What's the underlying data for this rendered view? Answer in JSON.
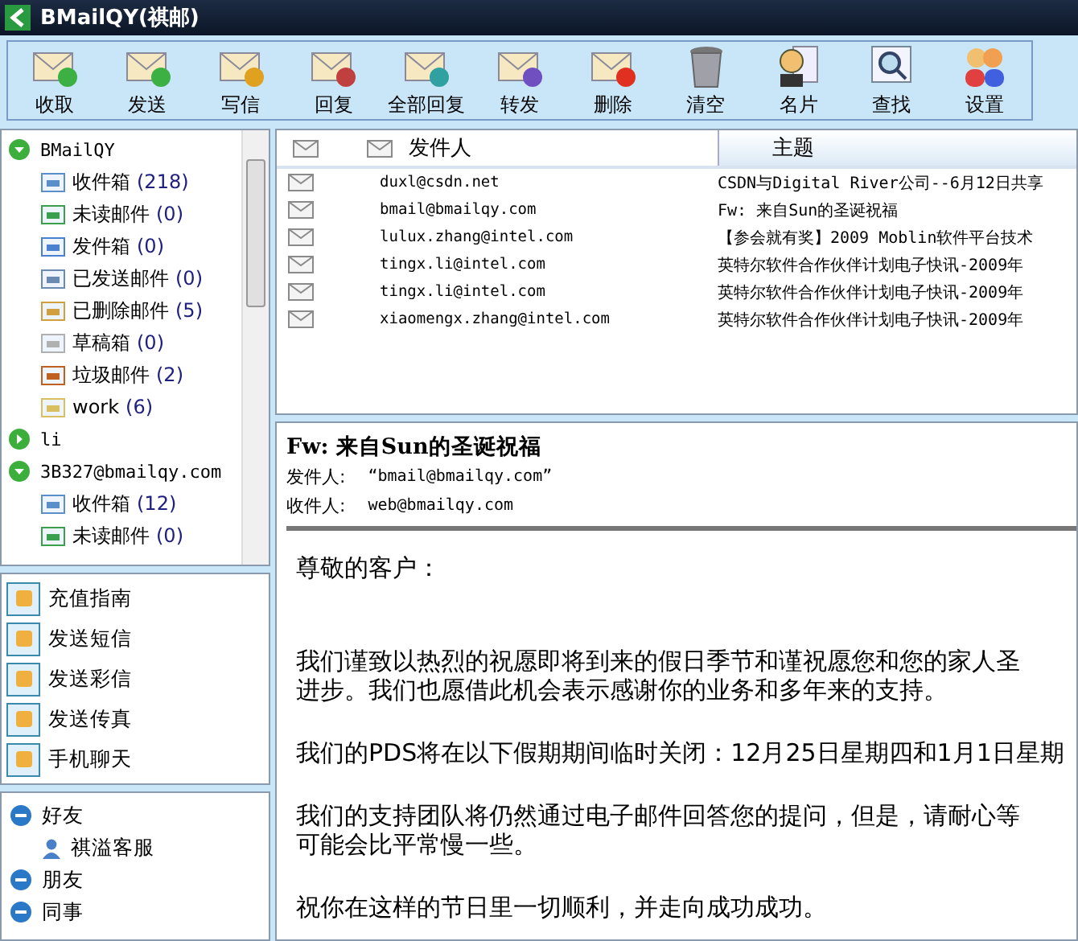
{
  "window": {
    "title": "BMailQY(祺邮)"
  },
  "toolbar": [
    "收取",
    "发送",
    "写信",
    "回复",
    "全部回复",
    "转发",
    "删除",
    "清空",
    "名片",
    "查找",
    "设置"
  ],
  "folder_tree": [
    {
      "label": "BMailQY",
      "expanded": true,
      "children": [
        {
          "label": "收件箱",
          "count": "(218)"
        },
        {
          "label": "未读邮件",
          "count": "(0)"
        },
        {
          "label": "发件箱",
          "count": "(0)"
        },
        {
          "label": "已发送邮件",
          "count": "(0)"
        },
        {
          "label": "已删除邮件",
          "count": "(5)"
        },
        {
          "label": "草稿箱",
          "count": "(0)"
        },
        {
          "label": "垃圾邮件",
          "count": "(2)"
        },
        {
          "label": "work",
          "count": "(6)"
        }
      ]
    },
    {
      "label": "li",
      "expanded": false
    },
    {
      "label": "3B327@bmailqy.com",
      "expanded": true,
      "children": [
        {
          "label": "收件箱",
          "count": "(12)"
        },
        {
          "label": "未读邮件",
          "count": "(0)"
        }
      ]
    }
  ],
  "quick_actions": [
    "充值指南",
    "发送短信",
    "发送彩信",
    "发送传真",
    "手机聊天"
  ],
  "contacts": [
    {
      "label": "好友",
      "expanded": true,
      "children": [
        {
          "label": "祺溢客服"
        }
      ]
    },
    {
      "label": "朋友",
      "expanded": true
    },
    {
      "label": "同事",
      "expanded": true
    }
  ],
  "message_list": {
    "columns": [
      "发件人",
      "主题"
    ],
    "rows": [
      {
        "sender": "duxl@csdn.net",
        "subject": "CSDN与Digital River公司--6月12日共享"
      },
      {
        "sender": "bmail@bmailqy.com",
        "subject": "Fw: 来自Sun的圣诞祝福"
      },
      {
        "sender": "lulux.zhang@intel.com",
        "subject": "【参会就有奖】2009 Moblin软件平台技术"
      },
      {
        "sender": "tingx.li@intel.com",
        "subject": "英特尔软件合作伙伴计划电子快讯-2009年"
      },
      {
        "sender": "tingx.li@intel.com",
        "subject": "英特尔软件合作伙伴计划电子快讯-2009年"
      },
      {
        "sender": "xiaomengx.zhang@intel.com",
        "subject": "英特尔软件合作伙伴计划电子快讯-2009年"
      }
    ]
  },
  "preview": {
    "subject": "Fw: 来自Sun的圣诞祝福",
    "from_label": "发件人:",
    "from": "“bmail@bmailqy.com”",
    "to_label": "收件人:",
    "to": "web@bmailqy.com",
    "body": [
      [
        "尊敬的客户："
      ],
      [
        "我们谨致以热烈的祝愿即将到来的假日季节和谨祝愿您和您的家人圣",
        "进步。我们也愿借此机会表示感谢你的业务和多年来的支持。"
      ],
      [
        "我们的PDS将在以下假期期间临时关闭：12月25日星期四和1月1日星期"
      ],
      [
        "我们的支持团队将仍然通过电子邮件回答您的提问，但是，请耐心等",
        "可能会比平常慢一些。"
      ],
      [
        "祝你在这样的节日里一切顺利，并走向成功成功。"
      ]
    ]
  }
}
